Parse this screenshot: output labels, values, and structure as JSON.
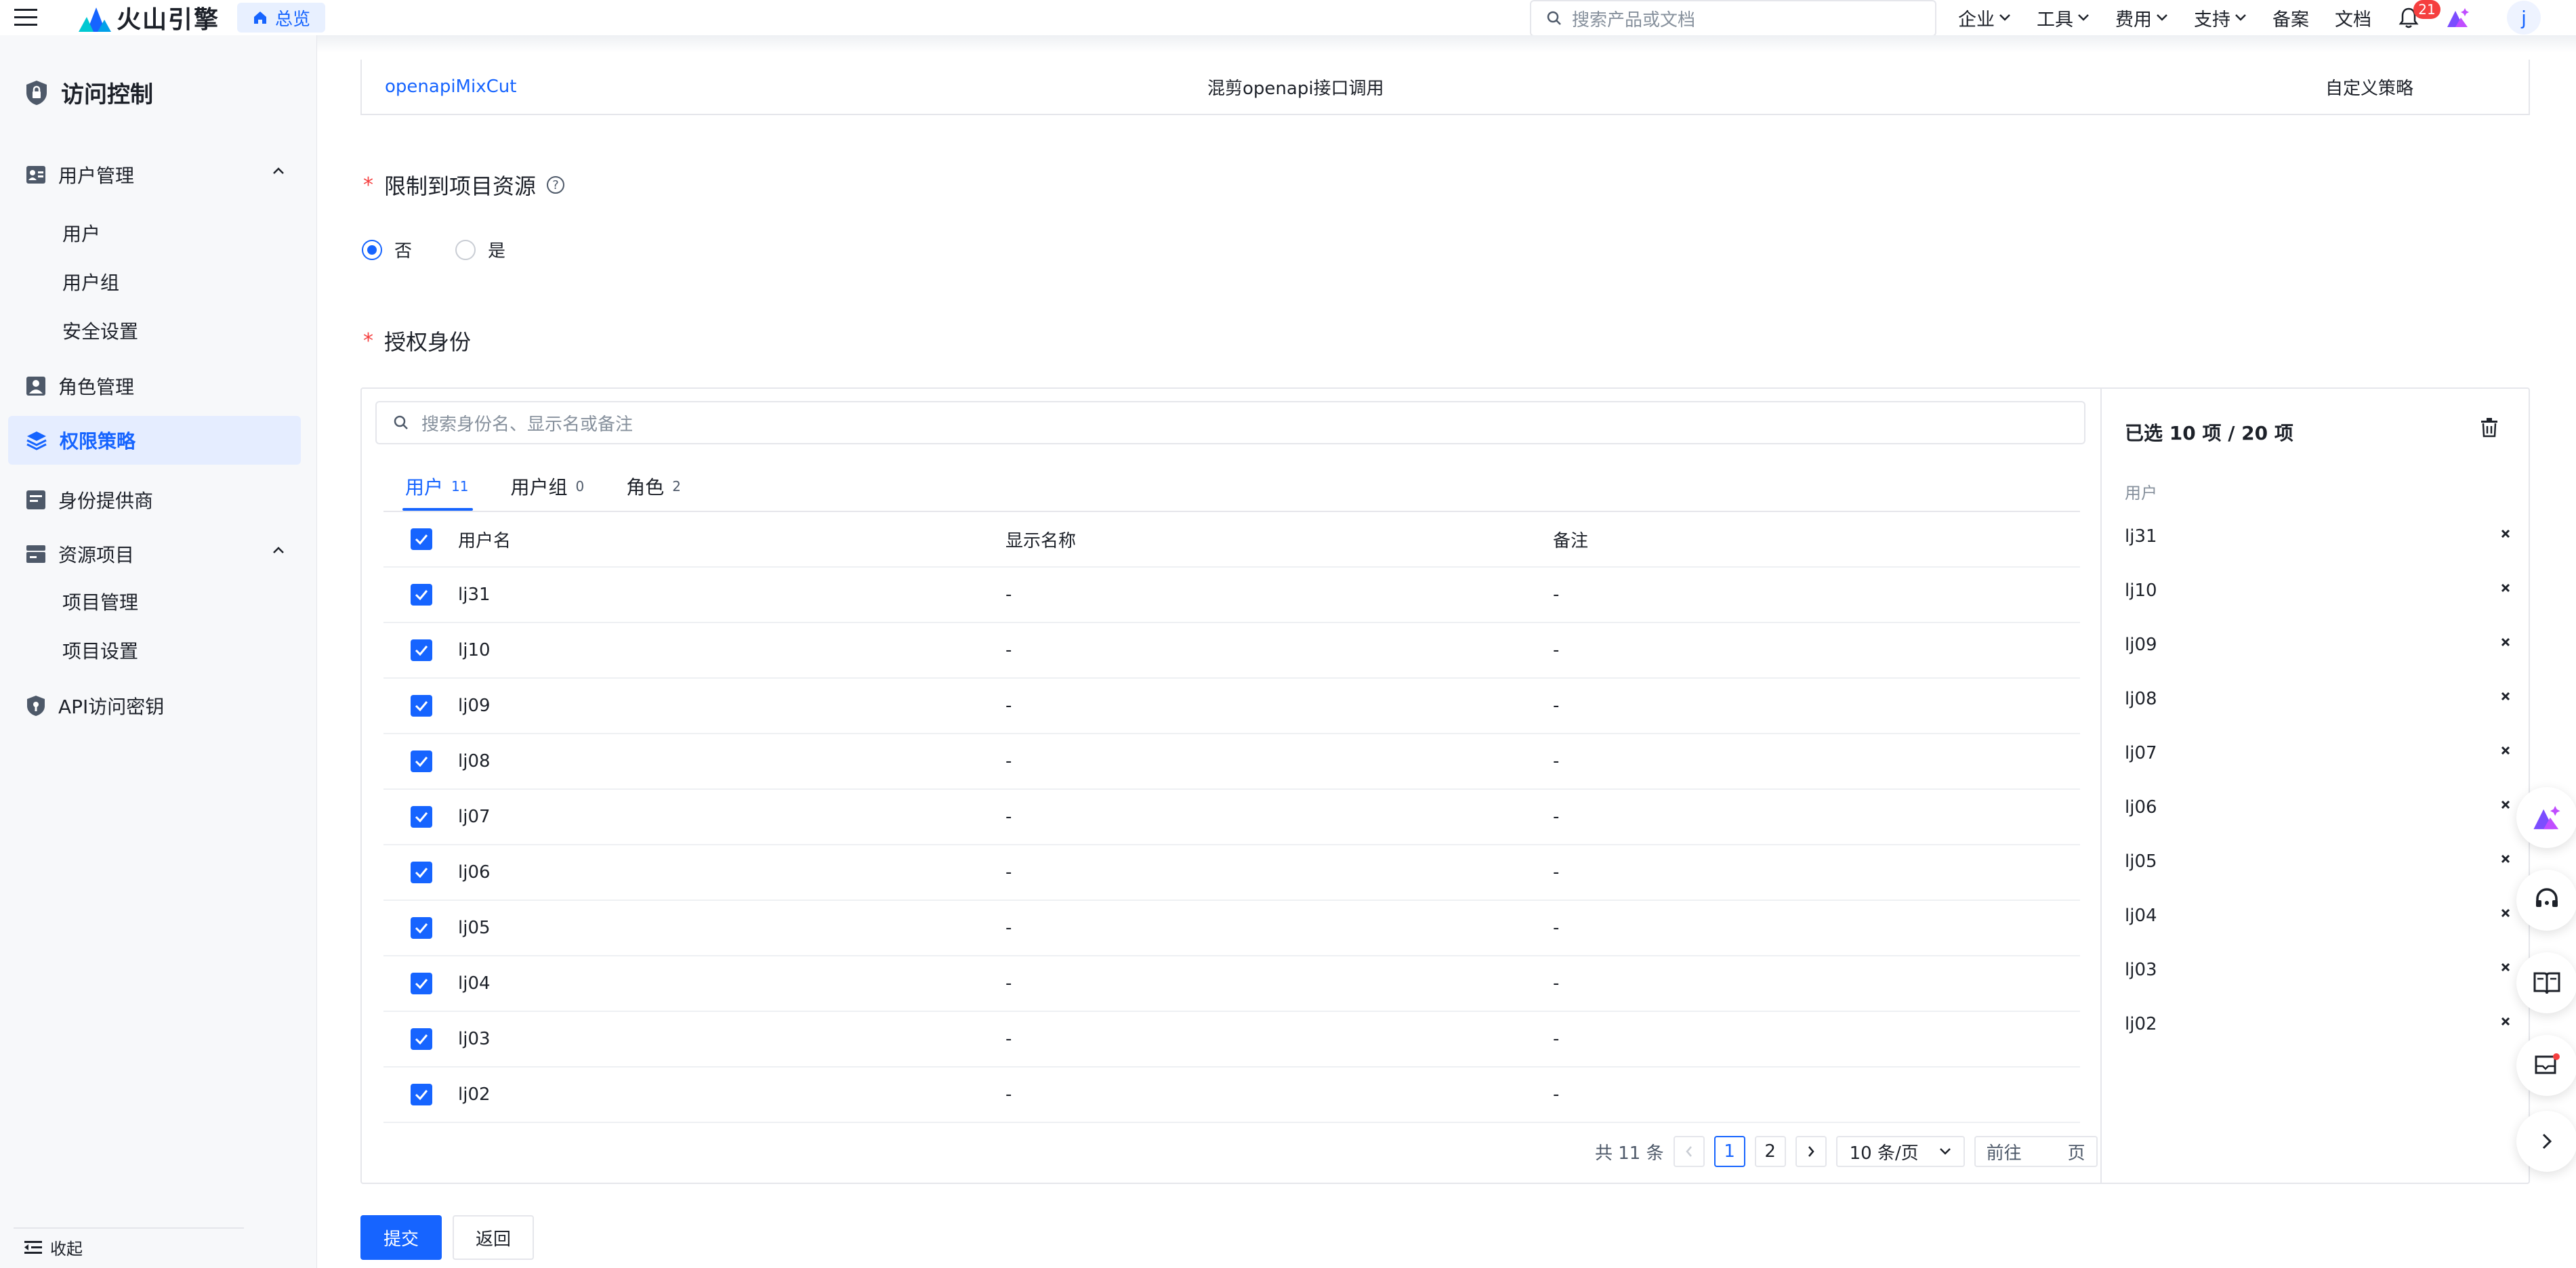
{
  "header": {
    "brand": "火山引擎",
    "home_label": "总览",
    "search_placeholder": "搜索产品或文档",
    "menu": [
      {
        "label": "企业"
      },
      {
        "label": "工具"
      },
      {
        "label": "费用"
      },
      {
        "label": "支持"
      }
    ],
    "links": [
      "备案",
      "文档"
    ],
    "notification_count": "21",
    "avatar_letter": "j"
  },
  "sidebar": {
    "title": "访问控制",
    "groups": [
      {
        "label": "用户管理",
        "items": [
          "用户",
          "用户组",
          "安全设置"
        ]
      },
      {
        "label": "角色管理"
      },
      {
        "label": "权限策略"
      },
      {
        "label": "身份提供商"
      },
      {
        "label": "资源项目",
        "items": [
          "项目管理",
          "项目设置"
        ]
      },
      {
        "label": "API访问密钥"
      }
    ],
    "active": "权限策略",
    "collapse_label": "收起"
  },
  "policy_row": {
    "name": "openapiMixCut",
    "description": "混剪openapi接口调用",
    "type": "自定义策略"
  },
  "restrict": {
    "label": "限制到项目资源",
    "options": [
      "否",
      "是"
    ],
    "selected": "否"
  },
  "auth": {
    "label": "授权身份",
    "search_placeholder": "搜索身份名、显示名或备注",
    "tabs": [
      {
        "label": "用户",
        "count": "11"
      },
      {
        "label": "用户组",
        "count": "0"
      },
      {
        "label": "角色",
        "count": "2"
      }
    ],
    "active_tab": "用户",
    "columns": [
      "用户名",
      "显示名称",
      "备注"
    ],
    "rows": [
      {
        "username": "lj31",
        "display": "-",
        "note": "-"
      },
      {
        "username": "lj10",
        "display": "-",
        "note": "-"
      },
      {
        "username": "lj09",
        "display": "-",
        "note": "-"
      },
      {
        "username": "lj08",
        "display": "-",
        "note": "-"
      },
      {
        "username": "lj07",
        "display": "-",
        "note": "-"
      },
      {
        "username": "lj06",
        "display": "-",
        "note": "-"
      },
      {
        "username": "lj05",
        "display": "-",
        "note": "-"
      },
      {
        "username": "lj04",
        "display": "-",
        "note": "-"
      },
      {
        "username": "lj03",
        "display": "-",
        "note": "-"
      },
      {
        "username": "lj02",
        "display": "-",
        "note": "-"
      }
    ],
    "pagination": {
      "total": "共 11 条",
      "pages": [
        "1",
        "2"
      ],
      "current": "1",
      "page_size": "10 条/页",
      "jump_prefix": "前往",
      "jump_suffix": "页"
    },
    "selected": {
      "summary": "已选 10 项 / 20 项",
      "category": "用户",
      "items": [
        "lj31",
        "lj10",
        "lj09",
        "lj08",
        "lj07",
        "lj06",
        "lj05",
        "lj04",
        "lj03",
        "lj02"
      ]
    }
  },
  "actions": {
    "submit": "提交",
    "back": "返回"
  },
  "colors": {
    "primary": "#1664ff",
    "danger": "#f53f3f",
    "border": "#e5e6eb"
  }
}
